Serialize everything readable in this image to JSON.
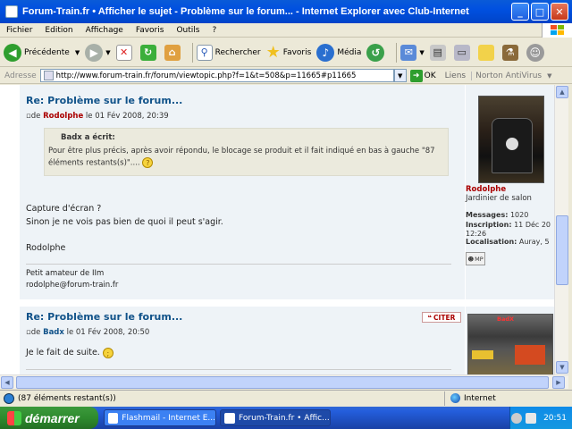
{
  "window": {
    "title": "Forum-Train.fr • Afficher le sujet - Problème sur le forum... - Internet Explorer avec Club-Internet",
    "buttons": {
      "minimize": "_",
      "maximize": "□",
      "close": "✕"
    }
  },
  "menu": [
    "Fichier",
    "Edition",
    "Affichage",
    "Favoris",
    "Outils",
    "?"
  ],
  "toolbar": {
    "back": "Précédente",
    "search": "Rechercher",
    "favorites": "Favoris",
    "media": "Média"
  },
  "address": {
    "label": "Adresse",
    "url": "http://www.forum-train.fr/forum/viewtopic.php?f=1&t=508&p=11665#p11665",
    "ok": "OK",
    "links": "Liens",
    "norton": "Norton AntiVirus"
  },
  "posts": [
    {
      "title": "Re: Problème sur le forum...",
      "meta_prefix": "de",
      "author": "Rodolphe",
      "meta_date": "le 01 Fév 2008, 20:39",
      "quote_author": "Badx a écrit:",
      "quote_text": "Pour être plus précis, après avoir répondu, le blocage se produit et il fait indiqué en bas à gauche \"87 éléments restants(s)\"....",
      "body_lines": [
        "Capture d'écran ?",
        "Sinon je ne vois pas bien de quoi il peut s'agir."
      ],
      "closing": "Rodolphe",
      "signature": [
        "Petit amateur de IIm",
        "rodolphe@forum-train.fr"
      ],
      "profile": {
        "name": "Rodolphe",
        "rank": "Jardinier de salon",
        "messages_label": "Messages:",
        "messages": "1020",
        "inscription_label": "Inscription:",
        "inscription": "11 Déc 20",
        "inscription_cont": "12:26",
        "localisation_label": "Localisation:",
        "localisation": "Auray, 5",
        "pm": "MP"
      }
    },
    {
      "title": "Re: Problème sur le forum...",
      "meta_prefix": "de",
      "author": "Badx",
      "meta_date": "le 01 Fév 2008, 20:50",
      "body": "Je le fait de suite.",
      "quote_button": "CITER",
      "avatar_tag": "BadX"
    }
  ],
  "status": {
    "text": "(87 éléments restant(s))",
    "zone": "Internet"
  },
  "taskbar": {
    "start": "démarrer",
    "tasks": [
      "Flashmail - Internet E...",
      "Forum-Train.fr • Affic..."
    ],
    "clock": "20:51"
  }
}
